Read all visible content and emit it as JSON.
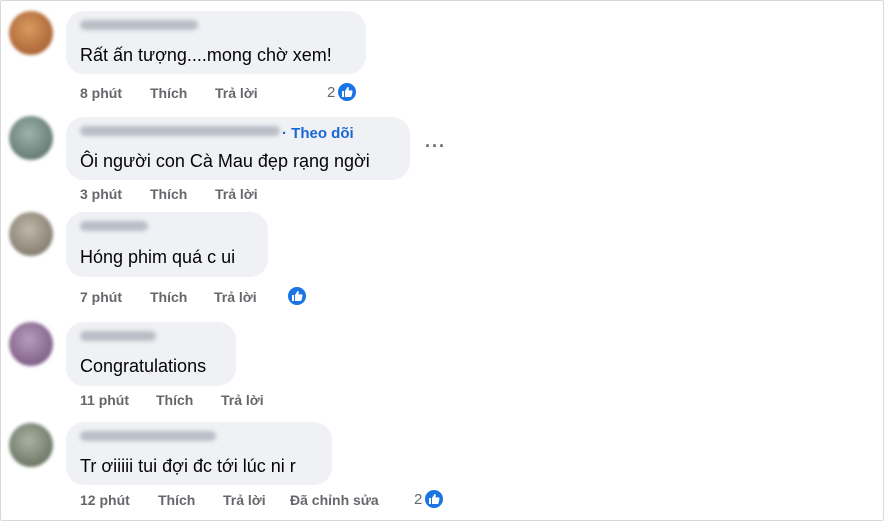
{
  "comments": [
    {
      "text": "Rất ấn tượng....mong chờ xem!",
      "time": "8 phút",
      "like_action": "Thích",
      "reply_action": "Trả lời",
      "reactions": {
        "count": "2",
        "icon": "like-icon"
      },
      "avatar_color": "#b86b3a"
    },
    {
      "follow": "· Theo dõi",
      "text": "Ôi người con Cà Mau đẹp rạng ngời",
      "time": "3 phút",
      "like_action": "Thích",
      "reply_action": "Trả lời",
      "more": "···",
      "avatar_color": "#6f8a82"
    },
    {
      "text": "Hóng phim quá c ui",
      "time": "7 phút",
      "like_action": "Thích",
      "reply_action": "Trả lời",
      "reactions": {
        "count": "",
        "icon": "like-icon"
      },
      "avatar_color": "#9a9385"
    },
    {
      "text": "Congratulations",
      "time": "11 phút",
      "like_action": "Thích",
      "reply_action": "Trả lời",
      "avatar_color": "#8e6f92"
    },
    {
      "text": "Tr ơiiiii tui đợi đc tới lúc ni r",
      "time": "12 phút",
      "like_action": "Thích",
      "reply_action": "Trả lời",
      "edited": "Đã chỉnh sửa",
      "reactions": {
        "count": "2",
        "icon": "like-icon"
      },
      "avatar_color": "#7f8b7a"
    }
  ],
  "colors": {
    "bubble": "#eff1f4",
    "accent": "#1b74e4",
    "meta": "#65676b"
  }
}
